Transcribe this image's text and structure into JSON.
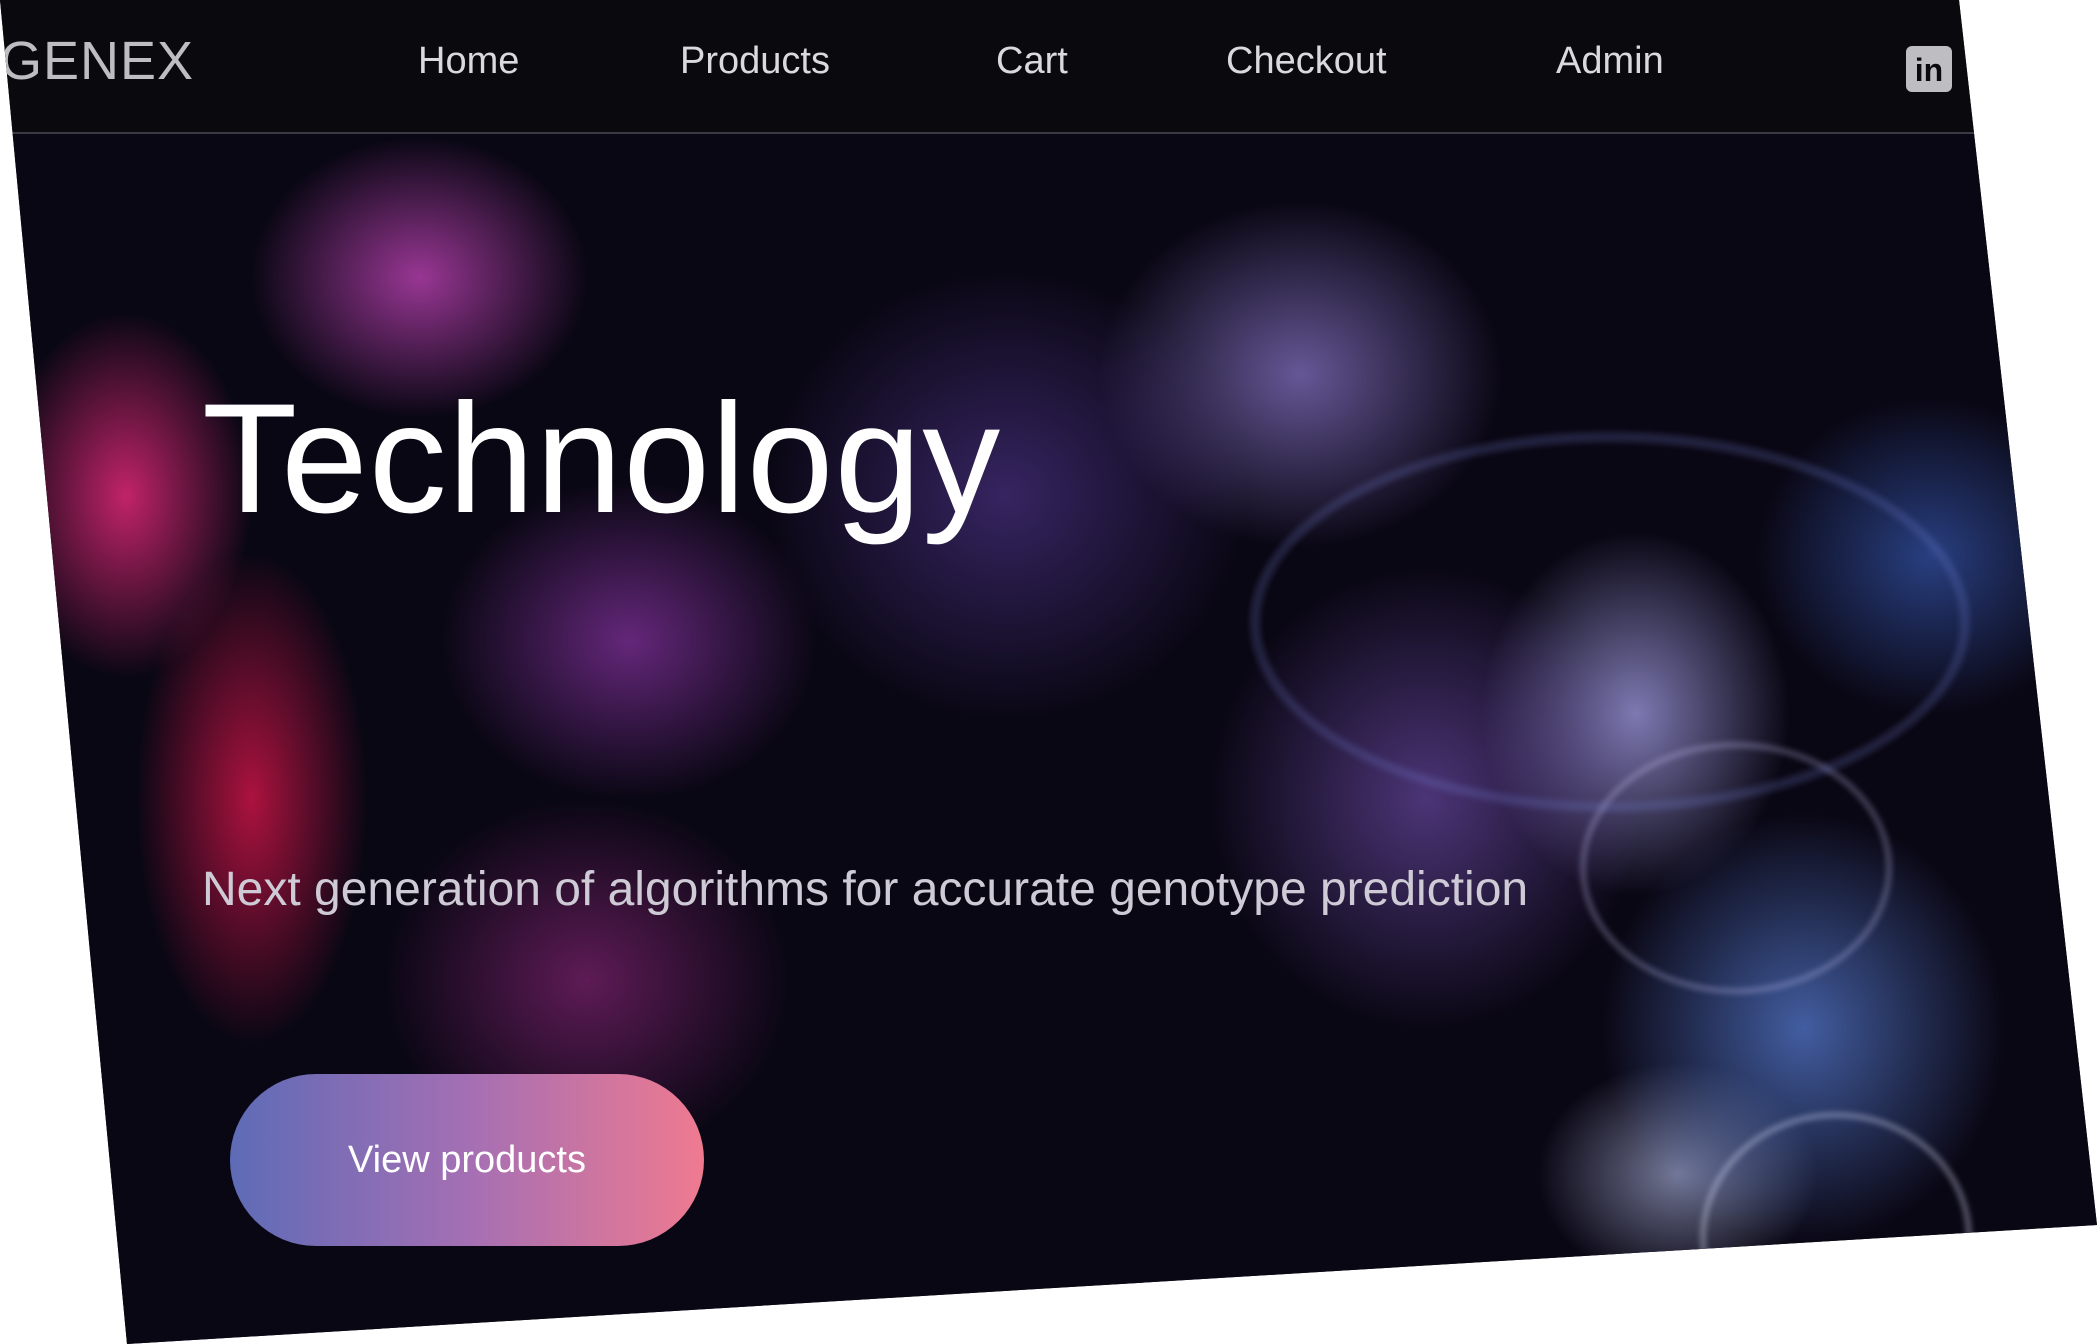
{
  "brand": {
    "logo_text": "GENEX"
  },
  "nav": {
    "items": [
      {
        "label": "Home"
      },
      {
        "label": "Products"
      },
      {
        "label": "Cart"
      },
      {
        "label": "Checkout"
      },
      {
        "label": "Admin"
      }
    ],
    "social_icon": "linkedin-icon",
    "social_icon_text": "in"
  },
  "hero": {
    "title": "Technology",
    "subtitle": "Next generation of algorithms for accurate genotype prediction",
    "cta_label": "View products"
  },
  "colors": {
    "nav_background": "#0a0a0e",
    "cta_gradient_start": "#5e6bb6",
    "cta_gradient_end": "#ef7a90",
    "hero_background": "#0a0714"
  }
}
